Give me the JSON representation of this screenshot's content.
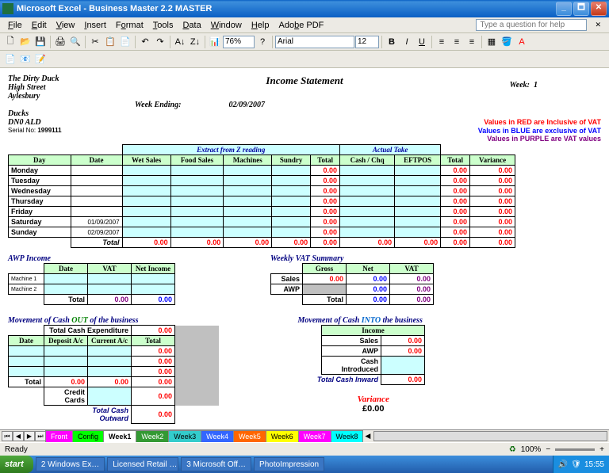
{
  "app": {
    "title": "Microsoft Excel - Business Master 2.2 MASTER",
    "helpPlaceholder": "Type a question for help"
  },
  "menu": [
    "File",
    "Edit",
    "View",
    "Insert",
    "Format",
    "Tools",
    "Data",
    "Window",
    "Help",
    "Adobe PDF"
  ],
  "toolbar": {
    "zoom": "76%",
    "font": "Arial",
    "size": "12"
  },
  "doc": {
    "title": "Income Statement",
    "addr": [
      "The Dirty Duck",
      "High Street",
      "Aylesbury",
      "",
      "Ducks",
      "DN0 ALD"
    ],
    "serialLabel": "Serial No:",
    "serial": "1999111",
    "weekLabel": "Week:",
    "weekNum": "1",
    "weekEndingLabel": "Week Ending:",
    "weekEndingDate": "02/09/2007",
    "vatNotes": [
      "Values in RED are Inclusive of VAT",
      "Values in BLUE are exclusive of VAT",
      "Values in PURPLE are VAT values"
    ]
  },
  "main": {
    "group1": "Extract from Z reading",
    "group2": "Actual Take",
    "cols": [
      "Day",
      "Date",
      "Wet Sales",
      "Food Sales",
      "Machines",
      "Sundry",
      "Total",
      "Cash / Chq",
      "EFTPOS",
      "Total",
      "Variance"
    ],
    "rows": [
      {
        "day": "Monday",
        "date": "",
        "t": "0.00",
        "at": "0.00",
        "v": "0.00"
      },
      {
        "day": "Tuesday",
        "date": "",
        "t": "0.00",
        "at": "0.00",
        "v": "0.00"
      },
      {
        "day": "Wednesday",
        "date": "",
        "t": "0.00",
        "at": "0.00",
        "v": "0.00"
      },
      {
        "day": "Thursday",
        "date": "",
        "t": "0.00",
        "at": "0.00",
        "v": "0.00"
      },
      {
        "day": "Friday",
        "date": "",
        "t": "0.00",
        "at": "0.00",
        "v": "0.00"
      },
      {
        "day": "Saturday",
        "date": "01/09/2007",
        "t": "0.00",
        "at": "0.00",
        "v": "0.00"
      },
      {
        "day": "Sunday",
        "date": "02/09/2007",
        "t": "0.00",
        "at": "0.00",
        "v": "0.00"
      }
    ],
    "totalLabel": "Total",
    "totals": {
      "wet": "0.00",
      "food": "0.00",
      "mach": "0.00",
      "sund": "0.00",
      "t": "0.00",
      "cash": "0.00",
      "eft": "0.00",
      "at": "0.00",
      "v": "0.00"
    }
  },
  "awp": {
    "title": "AWP Income",
    "cols": [
      "Date",
      "VAT",
      "Net Income"
    ],
    "rows": [
      "Machine 1",
      "Machine 2"
    ],
    "totalLabel": "Total",
    "totals": [
      "0.00",
      "0.00"
    ]
  },
  "vatSummary": {
    "title": "Weekly VAT Summary",
    "cols": [
      "Gross",
      "Net",
      "VAT"
    ],
    "rows": [
      {
        "l": "Sales",
        "g": "0.00",
        "n": "0.00",
        "v": "0.00"
      },
      {
        "l": "AWP",
        "g": "",
        "n": "0.00",
        "v": "0.00"
      }
    ],
    "totalLabel": "Total",
    "totals": [
      "0.00",
      "0.00",
      "0.00"
    ]
  },
  "cashOut": {
    "title": "Movement of Cash",
    "title2": "OUT",
    "title3": "of the business",
    "header": "Total Cash Expenditure",
    "headerVal": "0.00",
    "cols": [
      "Date",
      "Deposit A/c",
      "Current A/c",
      "Total"
    ],
    "rows": [
      [
        "",
        "",
        "",
        "0.00"
      ],
      [
        "",
        "",
        "",
        "0.00"
      ],
      [
        "",
        "",
        "",
        "0.00"
      ]
    ],
    "totalLabel": "Total",
    "totals": [
      "0.00",
      "0.00",
      "0.00"
    ],
    "ccLabel": "Credit Cards",
    "ccVal": "0.00",
    "outwardLabel": "Total Cash Outward",
    "outwardVal": "0.00"
  },
  "cashIn": {
    "title": "Movement of Cash",
    "title2": "INTO",
    "title3": "the business",
    "header": "Income",
    "rows": [
      {
        "l": "Sales",
        "v": "0.00"
      },
      {
        "l": "AWP",
        "v": "0.00"
      },
      {
        "l": "Cash Introduced",
        "v": ""
      }
    ],
    "inwardLabel": "Total Cash Inward",
    "inwardVal": "0.00"
  },
  "variance": {
    "label": "Variance",
    "val": "£0.00"
  },
  "tabs": [
    "Front",
    "Config",
    "Week1",
    "Week2",
    "Week3",
    "Week4",
    "Week5",
    "Week6",
    "Week7",
    "Week8"
  ],
  "status": {
    "ready": "Ready",
    "zoom": "100%"
  },
  "taskbar": {
    "start": "start",
    "items": [
      "2 Windows Ex…",
      "Licensed Retail …",
      "3 Microsoft Off…",
      "PhotoImpression"
    ],
    "time": "15:55"
  }
}
